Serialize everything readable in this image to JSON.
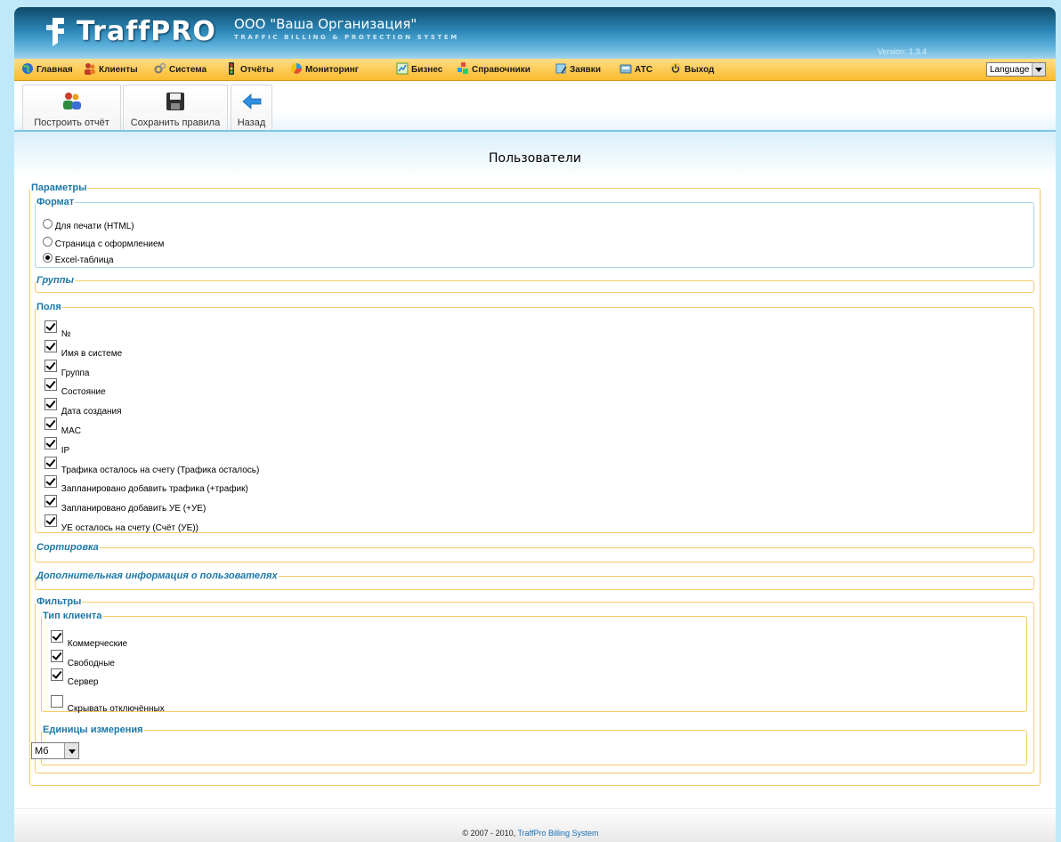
{
  "header": {
    "logo": "TraffPRO",
    "org_name": "ООО \"Ваша Организация\"",
    "org_tag": "TRAFFIC BILLING & PROTECTION SYSTEM",
    "version": "Version: 1.3.4"
  },
  "menu": {
    "items": [
      {
        "label": "Главная",
        "icon": "globe-icon"
      },
      {
        "label": "Клиенты",
        "icon": "users-icon"
      },
      {
        "label": "Система",
        "icon": "gears-icon"
      },
      {
        "label": "Отчёты",
        "icon": "traffic-light-icon"
      },
      {
        "label": "Мониторинг",
        "icon": "chart-icon"
      },
      {
        "label": "Бизнес",
        "icon": "business-icon"
      },
      {
        "label": "Справочники",
        "icon": "blocks-icon"
      },
      {
        "label": "Заявки",
        "icon": "note-icon"
      },
      {
        "label": "АТС",
        "icon": "phone-icon"
      },
      {
        "label": "Выход",
        "icon": "power-icon"
      }
    ],
    "language": "Language"
  },
  "toolbar": {
    "build_report": "Построить отчёт",
    "save_rules": "Сохранить правила",
    "back": "Назад"
  },
  "page": {
    "title": "Пользователи"
  },
  "params": {
    "legend": "Параметры",
    "format": {
      "legend": "Формат",
      "options": [
        "Для печати (HTML)",
        "Страница с оформлением",
        "Excel-таблица"
      ],
      "selected_index": 2
    },
    "groups_legend": "Группы",
    "fields": {
      "legend": "Поля",
      "items": [
        "№",
        "Имя в системе",
        "Группа",
        "Состояние",
        "Дата создания",
        "MAC",
        "IP",
        "Трафика осталось на счету (Трафика осталось)",
        "Запланировано добавить трафика (+трафик)",
        "Запланировано добавить УЕ (+УЕ)",
        "УЕ осталось на счету (Счёт (УЕ))"
      ],
      "checked": true
    },
    "sort_legend": "Сортировка",
    "extra_legend": "Дополнительная информация о пользователях",
    "filters": {
      "legend": "Фильтры",
      "client_type": {
        "legend": "Тип клиента",
        "items": [
          "Коммерческие",
          "Свободные",
          "Сервер"
        ],
        "hide_disabled": "Скрывать отключённых",
        "hide_disabled_checked": false
      },
      "units": {
        "legend": "Единицы измерения",
        "value": "Мб"
      }
    }
  },
  "footer": {
    "copyright": "© 2007 - 2010, ",
    "link": "TraffPro Billing System"
  }
}
